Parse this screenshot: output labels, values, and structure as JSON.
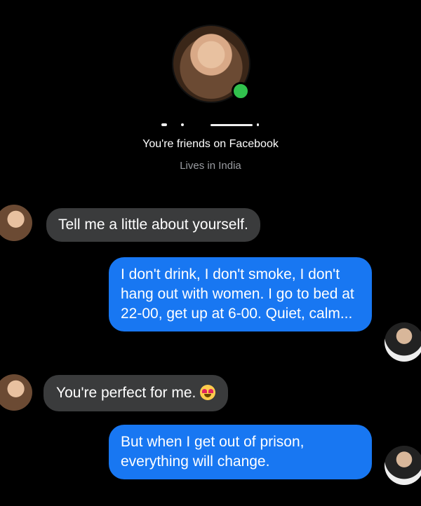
{
  "contact": {
    "status": "online",
    "friends_text": "You're friends on Facebook",
    "lives_text": "Lives in India"
  },
  "messages": [
    {
      "from": "them",
      "text": "Tell me a little about yourself."
    },
    {
      "from": "me",
      "text": "I don't drink, I don't smoke, I don't hang out with women. I go to bed at 22-00, get up at 6-00. Quiet, calm..."
    },
    {
      "from": "them",
      "text": "You're perfect for me.",
      "emoji": "heart-eyes-emoji"
    },
    {
      "from": "me",
      "text": "But when I get out of prison, everything will change."
    }
  ],
  "colors": {
    "background": "#000000",
    "incoming_bubble": "#3a3b3c",
    "outgoing_bubble": "#1877f2",
    "online": "#31c24d"
  }
}
